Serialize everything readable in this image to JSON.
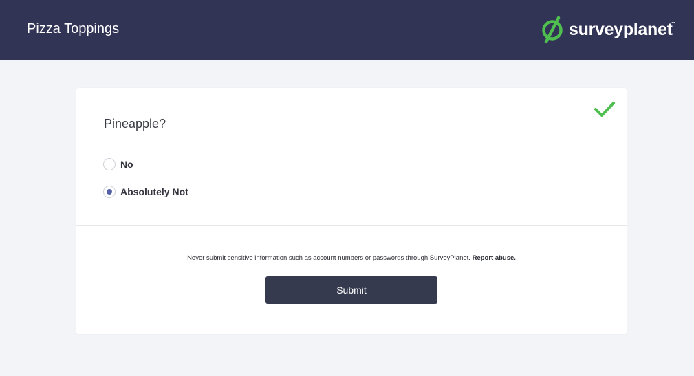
{
  "header": {
    "title": "Pizza Toppings",
    "brand": {
      "name": "surveyplanet",
      "tm": "™",
      "logo_icon": "surveyplanet-logo-icon"
    }
  },
  "question": {
    "text": "Pineapple?",
    "answered_icon": "checkmark-icon",
    "options": [
      {
        "label": "No",
        "selected": false
      },
      {
        "label": "Absolutely Not",
        "selected": true
      }
    ]
  },
  "footer": {
    "disclaimer": "Never submit sensitive information such as account numbers or passwords through SurveyPlanet.",
    "report_link": "Report abuse.",
    "submit_label": "Submit"
  },
  "colors": {
    "header_bg": "#323456",
    "brand_green": "#4fbf4f",
    "radio_selected": "#5461a5",
    "submit_bg": "#363a4e",
    "page_bg": "#f3f4f7"
  }
}
